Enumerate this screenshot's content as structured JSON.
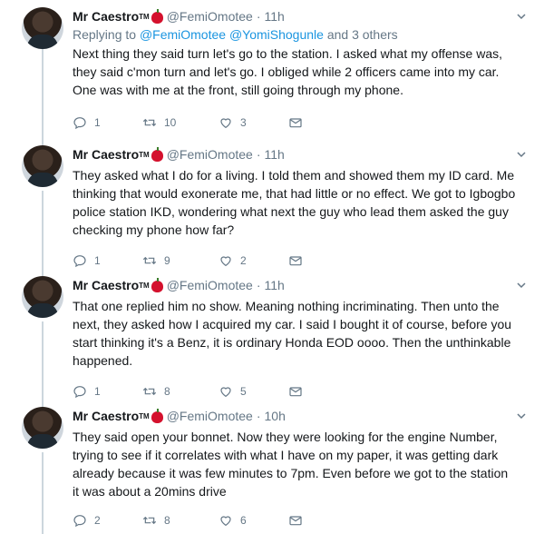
{
  "tweets": [
    {
      "name": "Mr Caestro",
      "tm": "TM",
      "handle": "@FemiOmotee",
      "dot": "·",
      "time": "11h",
      "replying_prefix": "Replying to",
      "replying_mentions": "@FemiOmotee @YomiShogunle",
      "replying_suffix": "and 3 others",
      "text": "Next thing they said turn let's go to the station. I asked what my offense was, they said c'mon turn and let's go. I obliged while 2 officers came into my car. One was with me at the front, still going through my phone.",
      "replies": "1",
      "retweets": "10",
      "likes": "3"
    },
    {
      "name": "Mr Caestro",
      "tm": "TM",
      "handle": "@FemiOmotee",
      "dot": "·",
      "time": "11h",
      "text": "They asked what I do for a living. I told them and showed them my ID card. Me thinking that would exonerate me, that had little or no effect. We got to Igbogbo police station IKD, wondering what next the guy who lead them asked the guy checking my phone how far?",
      "replies": "1",
      "retweets": "9",
      "likes": "2"
    },
    {
      "name": "Mr Caestro",
      "tm": "TM",
      "handle": "@FemiOmotee",
      "dot": "·",
      "time": "11h",
      "text": "That one replied him no show. Meaning nothing incriminating. Then unto the next, they asked how I acquired my car. I said I bought it of course, before you start thinking it's a Benz, it is ordinary Honda EOD oooo. Then the unthinkable happened.",
      "replies": "1",
      "retweets": "8",
      "likes": "5"
    },
    {
      "name": "Mr Caestro",
      "tm": "TM",
      "handle": "@FemiOmotee",
      "dot": "·",
      "time": "10h",
      "text": "They said open your bonnet. Now they were looking for the engine Number, trying to see if it correlates with what I have on my paper, it was getting dark already because it was few minutes to 7pm. Even before we got to the station it was about a 20mins drive",
      "replies": "2",
      "retweets": "8",
      "likes": "6"
    }
  ],
  "icons": {
    "reply": "reply-icon",
    "retweet": "retweet-icon",
    "like": "heart-icon",
    "dm": "envelope-icon",
    "caret": "chevron-down-icon"
  },
  "colors": {
    "link": "#1b95e0",
    "muted": "#657786",
    "apple": "#d4112d",
    "thread_line": "#ccd6dd"
  }
}
